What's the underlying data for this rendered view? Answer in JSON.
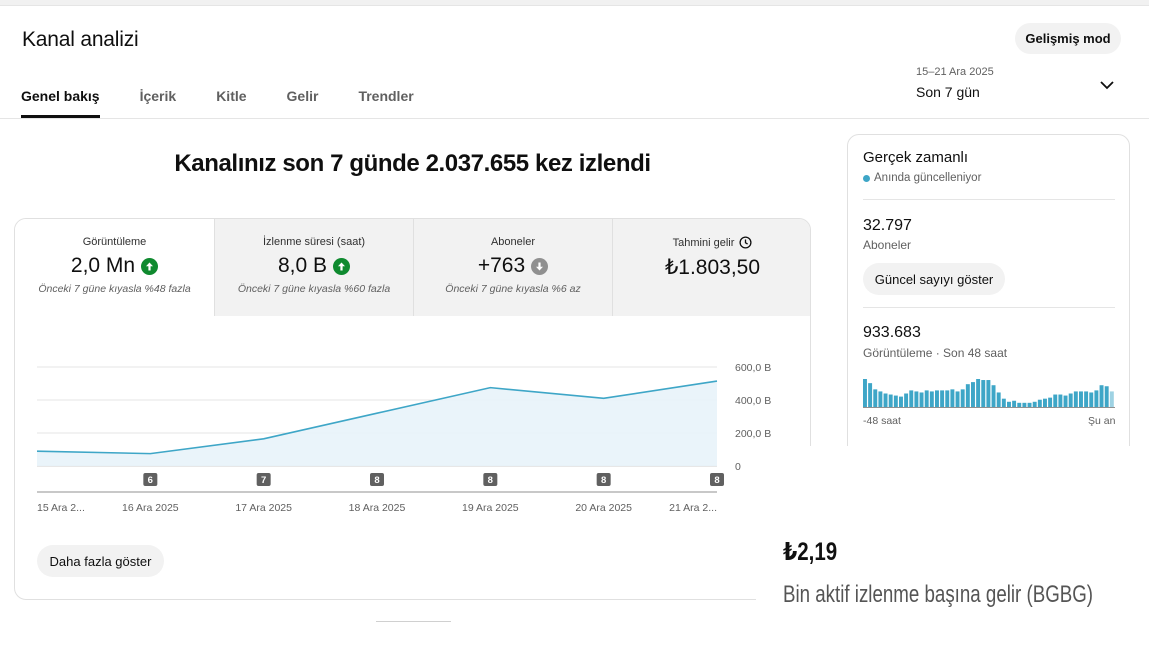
{
  "header": {
    "title": "Kanal analizi",
    "advanced_mode": "Gelişmiş mod"
  },
  "tabs": [
    {
      "label": "Genel bakış",
      "active": true
    },
    {
      "label": "İçerik",
      "active": false
    },
    {
      "label": "Kitle",
      "active": false
    },
    {
      "label": "Gelir",
      "active": false
    },
    {
      "label": "Trendler",
      "active": false
    }
  ],
  "date_picker": {
    "range": "15–21 Ara 2025",
    "label": "Son 7 gün"
  },
  "headline": "Kanalınız son 7 günde 2.037.655 kez izlendi",
  "metrics": [
    {
      "label": "Görüntüleme",
      "value": "2,0 Mn",
      "trend": "up",
      "note": "Önceki 7 güne kıyasla %48 fazla"
    },
    {
      "label": "İzlenme süresi (saat)",
      "value": "8,0 B",
      "trend": "up",
      "note": "Önceki 7 güne kıyasla %60 fazla"
    },
    {
      "label": "Aboneler",
      "value": "+763",
      "trend": "down",
      "note": "Önceki 7 güne kıyasla %6 az"
    },
    {
      "label": "Tahmini gelir",
      "value": "₺1.803,50",
      "trend": "",
      "note": ""
    }
  ],
  "chart_data": {
    "type": "area",
    "x": [
      "15 Ara 2...",
      "16 Ara 2025",
      "17 Ara 2025",
      "18 Ara 2025",
      "19 Ara 2025",
      "20 Ara 2025",
      "21 Ara 2..."
    ],
    "series": [
      {
        "values": [
          90000,
          75000,
          165000,
          320000,
          475000,
          410000,
          515000
        ]
      }
    ],
    "y_ticks": [
      "600,0 B",
      "400,0 B",
      "200,0 B",
      "0"
    ],
    "ylim": [
      0,
      600000
    ],
    "upload_markers": [
      {
        "x_index": 1,
        "count": "6"
      },
      {
        "x_index": 2,
        "count": "7"
      },
      {
        "x_index": 3,
        "count": "8"
      },
      {
        "x_index": 4,
        "count": "8"
      },
      {
        "x_index": 5,
        "count": "8"
      },
      {
        "x_index": 6,
        "count": "8"
      }
    ],
    "grid": true,
    "colors": {
      "line": "#3ea6c7",
      "fill": "#e8f3f9",
      "grid": "#e5e5e5",
      "marker": "#606060"
    }
  },
  "more_button": "Daha fazla göster",
  "realtime": {
    "title": "Gerçek zamanlı",
    "live": "Anında güncelleniyor",
    "subscribers": {
      "value": "32.797",
      "label": "Aboneler"
    },
    "show_count_button": "Güncel sayıyı göster",
    "views": {
      "value": "933.683",
      "label": "Görüntüleme · Son 48 saat"
    },
    "mini_bars": [
      28,
      24,
      18,
      16,
      14,
      13,
      12,
      11,
      14,
      17,
      16,
      15,
      17,
      16,
      17,
      17,
      17,
      18,
      16,
      18,
      23,
      25,
      28,
      27,
      27,
      22,
      15,
      9,
      6,
      7,
      5,
      5,
      5,
      6,
      8,
      9,
      10,
      13,
      13,
      12,
      14,
      16,
      16,
      16,
      15,
      17,
      22,
      21,
      16
    ],
    "axis_left": "-48 saat",
    "axis_right": "Şu an",
    "bar_color": "#3ea6c7"
  },
  "rpm": {
    "value": "₺2,19",
    "label": "Bin aktif izlenme başına gelir (BGBG)"
  }
}
